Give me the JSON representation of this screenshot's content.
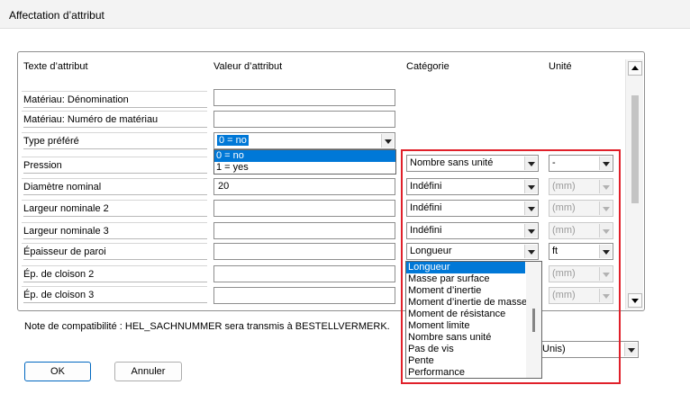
{
  "window": {
    "title": "Affectation d’attribut"
  },
  "headers": {
    "type": "Texte d’attribut",
    "value": "Valeur d’attribut",
    "category": "Catégorie",
    "unit": "Unité"
  },
  "rows": [
    {
      "label": "Matériau: Dénomination",
      "value": ""
    },
    {
      "label": "Matériau: Numéro de matériau",
      "value": ""
    },
    {
      "label": "Type préféré",
      "value": "0 = no"
    },
    {
      "label": "Pression",
      "value": "",
      "category": "Nombre sans unité",
      "unit": "-"
    },
    {
      "label": "Diamètre nominal",
      "value": "20",
      "category": "Indéfini",
      "unit": "(mm)"
    },
    {
      "label": "Largeur nominale 2",
      "value": "",
      "category": "Indéfini",
      "unit": "(mm)"
    },
    {
      "label": "Largeur nominale 3",
      "value": "",
      "category": "Indéfini",
      "unit": "(mm)"
    },
    {
      "label": "Épaisseur de paroi",
      "value": "",
      "category": "Longueur",
      "unit": "ft"
    },
    {
      "label": "Ép. de cloison 2",
      "value": "",
      "unit": "(mm)"
    },
    {
      "label": "Ép. de cloison 3",
      "value": "",
      "unit": "(mm)"
    }
  ],
  "type_dropdown": {
    "options": [
      "0 = no",
      "1 = yes"
    ],
    "selected": "0 = no"
  },
  "category_dropdown": {
    "options": [
      "Longueur",
      "Masse par surface",
      "Moment d’inertie",
      "Moment d’inertie de masse",
      "Moment de résistance",
      "Moment limite",
      "Nombre sans unité",
      "Pas de vis",
      "Pente",
      "Performance"
    ],
    "selected": "Longueur"
  },
  "note": "Note de compatibilité : HEL_SACHNUMMER sera transmis à BESTELLVERMERK.",
  "unit_system_select": {
    "value": "Unis)"
  },
  "buttons": {
    "ok": "OK",
    "cancel": "Annuler"
  },
  "colors": {
    "selection": "#0078d7",
    "highlight_frame": "#e0202a"
  }
}
